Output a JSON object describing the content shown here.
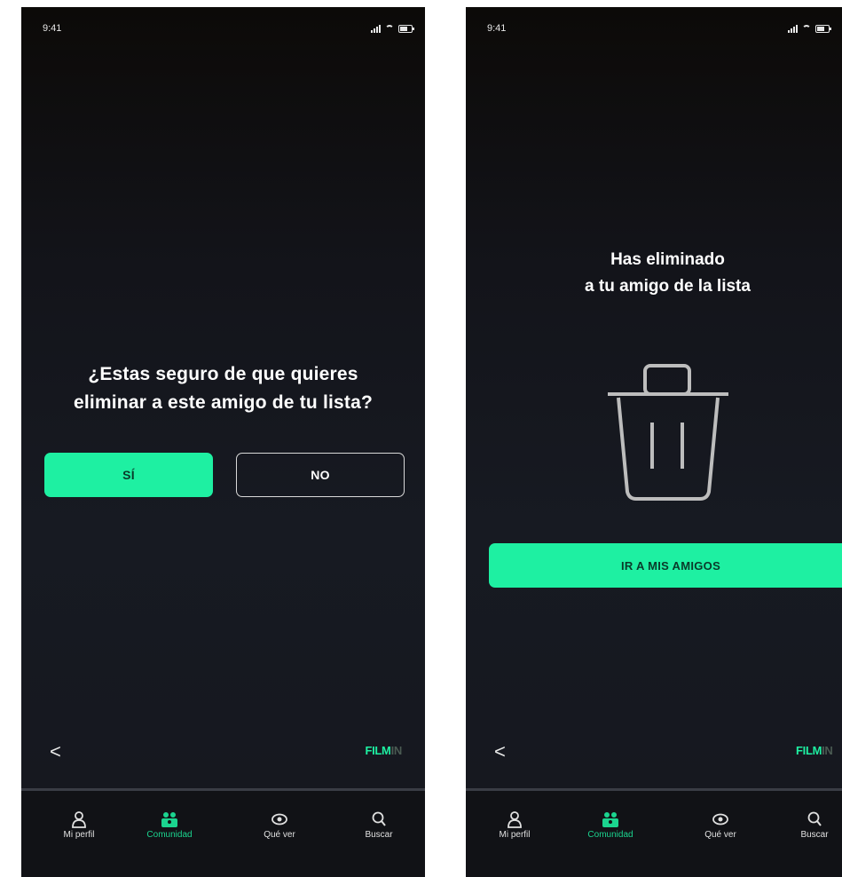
{
  "confirm": {
    "status_time": "9:41",
    "question_line1": "¿Estas seguro de que quieres",
    "question_line2": "eliminar a este amigo de tu lista?",
    "yes_label": "SÍ",
    "no_label": "NO",
    "back_glyph": "<",
    "logo_a": "FILM",
    "logo_b": "IN"
  },
  "done": {
    "status_time": "9:41",
    "title_line1": "Has eliminado",
    "title_line2": "a tu amigo de la lista",
    "cta_label": "IR A MIS AMIGOS",
    "back_glyph": "<",
    "logo_a": "FILM",
    "logo_b": "IN"
  },
  "tabs": [
    {
      "label": "Mi perfil",
      "icon": "user-icon"
    },
    {
      "label": "Comunidad",
      "icon": "community-icon",
      "active": true
    },
    {
      "label": "Qué ver",
      "icon": "eye-icon"
    },
    {
      "label": "Buscar",
      "icon": "search-icon"
    }
  ],
  "colors": {
    "accent": "#1ef0a2",
    "background": "#15171e",
    "tab_active": "#1bd48f"
  }
}
